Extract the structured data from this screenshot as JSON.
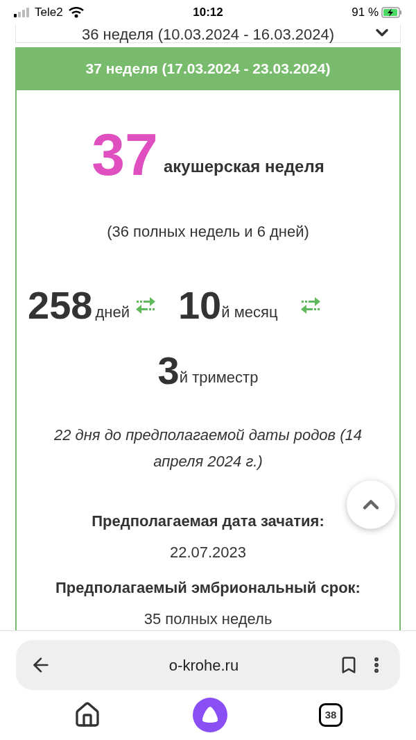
{
  "status_bar": {
    "carrier": "Tele2",
    "time": "10:12",
    "battery": "91 %"
  },
  "previous_week": {
    "label": "36 неделя (10.03.2024 - 16.03.2024)",
    "expanded": false
  },
  "current_week": {
    "label": "37 неделя (17.03.2024 - 23.03.2024)",
    "expanded": true,
    "week_number": "37",
    "week_label": "акушерская неделя",
    "week_detail": "(36 полных недель и 6 дней)",
    "days": {
      "value": "258",
      "unit": "дней"
    },
    "month": {
      "value": "10",
      "unit": "й месяц"
    },
    "trimester": {
      "value": "3",
      "unit": "й триместр"
    },
    "due_note": "22 дня до предполагаемой даты родов (14 апреля 2024 г.)",
    "facts": [
      {
        "label": "Предполагаемая дата зачатия:",
        "value": "22.07.2023"
      },
      {
        "label": "Предполагаемый эмбриональный срок:",
        "value": "35 полных недель"
      }
    ]
  },
  "browser": {
    "url": "o-krohe.ru",
    "tabs_count": "38"
  }
}
